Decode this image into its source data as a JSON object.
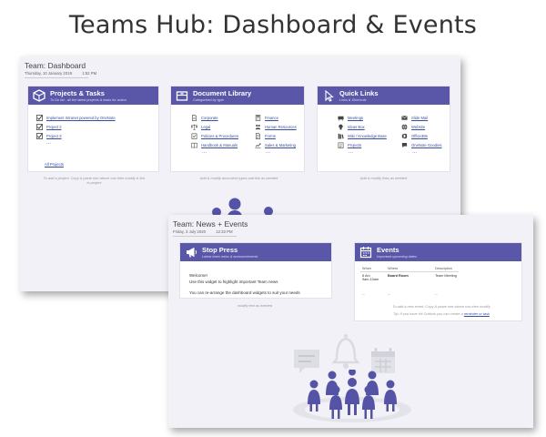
{
  "slide_title": "Teams Hub: Dashboard & Events",
  "dashboard": {
    "title": "Team: Dashboard",
    "date": "Thursday, 10 January 2019",
    "time": "1:52 PM",
    "projects": {
      "title": "Projects & Tasks",
      "subtitle": "To Do list - all the latest projects & tasks for action",
      "items": [
        "Implement Intranet powered by OneNote",
        "Project 2",
        "Project 3"
      ],
      "more": "...",
      "all_link": "All Projects",
      "note": "To add a project: Copy & paste one above row then modify & link to project"
    },
    "library": {
      "title": "Document Library",
      "subtitle": "Categorised by type",
      "col1": [
        "Corporate",
        "Legal",
        "Policies & Procedures",
        "Handbook & Manuals"
      ],
      "col2": [
        "Finance",
        "Human Resources",
        "Forms",
        "Sales & Marketing"
      ],
      "more1": "...",
      "more2": "...",
      "note": "Add & modify document types and link as needed"
    },
    "quicklinks": {
      "title": "Quick Links",
      "subtitle": "Links & Shortcuts",
      "col1": [
        "Meetings",
        "Ideas Box",
        "Wiki / Knowledge Base",
        "Projects"
      ],
      "col2": [
        "Slide Mail",
        "Website",
        "Office365",
        "OneNote Goodies"
      ],
      "more1": "...",
      "more2": "...",
      "note": "Add & modify links as needed"
    }
  },
  "news": {
    "title": "Team: News + Events",
    "date": "Friday, 3 July 2020",
    "time": "12:33 PM",
    "press": {
      "title": "Stop Press",
      "subtitle": "Latest team news & announcements",
      "lines": [
        "Welcome!",
        "Use this widget to highlight important Team news",
        "",
        "You can re-arrange the dashboard widgets to suit your needs"
      ],
      "note": "modify text as needed"
    },
    "events": {
      "title": "Events",
      "subtitle": "Important upcoming dates",
      "headers": [
        "When",
        "Where",
        "Description"
      ],
      "row": [
        "8 Am\n9am-10am",
        "Board Room",
        "Team Meeting"
      ],
      "more": [
        "...",
        "...",
        "..."
      ],
      "note1": "To add a new event: Copy & paste one above row then modify",
      "note2": "Tip: If you have Hit Outlook you can create a",
      "note2_link": "reminder or task"
    }
  },
  "colors": {
    "accent": "#5a57a8",
    "link": "#3b4fa0",
    "window_bg": "#f1f1f7"
  }
}
